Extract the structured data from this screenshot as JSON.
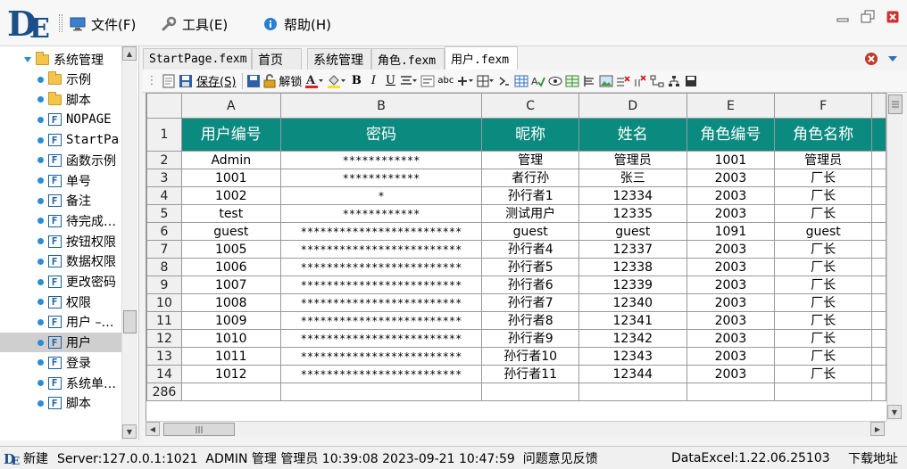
{
  "menu": {
    "file": "文件(F)",
    "tools": "工具(E)",
    "help": "帮助(H)"
  },
  "tree": {
    "root": "系统管理",
    "items": [
      {
        "label": "示例",
        "icon": "folder"
      },
      {
        "label": "脚本",
        "icon": "folder"
      },
      {
        "label": "NOPAGE",
        "icon": "function"
      },
      {
        "label": "StartPa",
        "icon": "function"
      },
      {
        "label": "函数示例",
        "icon": "function"
      },
      {
        "label": "单号",
        "icon": "function"
      },
      {
        "label": "备注",
        "icon": "function"
      },
      {
        "label": "待完成…",
        "icon": "function"
      },
      {
        "label": "按钮权限",
        "icon": "function"
      },
      {
        "label": "数据权限",
        "icon": "function"
      },
      {
        "label": "更改密码",
        "icon": "function"
      },
      {
        "label": "权限",
        "icon": "function"
      },
      {
        "label": "用户 –…",
        "icon": "function"
      },
      {
        "label": "用户",
        "icon": "function",
        "selected": true
      },
      {
        "label": "登录",
        "icon": "function"
      },
      {
        "label": "系统单…",
        "icon": "function"
      },
      {
        "label": "脚本",
        "icon": "function"
      }
    ]
  },
  "tabs": [
    {
      "label": "StartPage.fexm"
    },
    {
      "label": "首页"
    },
    {
      "label": "系统管理"
    },
    {
      "label": "角色.fexm"
    },
    {
      "label": "用户.fexm",
      "active": true
    }
  ],
  "toolbar": {
    "save": "保存(S)",
    "unlock": "解锁"
  },
  "grid": {
    "columns": [
      "A",
      "B",
      "C",
      "D",
      "E",
      "F"
    ],
    "header_row_num": "1",
    "headers": [
      "用户编号",
      "密码",
      "昵称",
      "姓名",
      "角色编号",
      "角色名称"
    ],
    "rows": [
      {
        "num": "2",
        "cells": [
          "Admin",
          "************",
          "管理",
          "管理员",
          "1001",
          "管理员"
        ]
      },
      {
        "num": "3",
        "cells": [
          "1001",
          "************",
          "者行孙",
          "张三",
          "2003",
          "厂长"
        ]
      },
      {
        "num": "4",
        "cells": [
          "1002",
          "*",
          "孙行者1",
          "12334",
          "2003",
          "厂长"
        ]
      },
      {
        "num": "5",
        "cells": [
          "test",
          "************",
          "测试用户",
          "12335",
          "2003",
          "厂长"
        ]
      },
      {
        "num": "6",
        "cells": [
          "guest",
          "*************************",
          "guest",
          "guest",
          "1091",
          "guest"
        ]
      },
      {
        "num": "7",
        "cells": [
          "1005",
          "*************************",
          "孙行者4",
          "12337",
          "2003",
          "厂长"
        ]
      },
      {
        "num": "8",
        "cells": [
          "1006",
          "*************************",
          "孙行者5",
          "12338",
          "2003",
          "厂长"
        ]
      },
      {
        "num": "9",
        "cells": [
          "1007",
          "*************************",
          "孙行者6",
          "12339",
          "2003",
          "厂长"
        ]
      },
      {
        "num": "10",
        "cells": [
          "1008",
          "*************************",
          "孙行者7",
          "12340",
          "2003",
          "厂长"
        ]
      },
      {
        "num": "11",
        "cells": [
          "1009",
          "*************************",
          "孙行者8",
          "12341",
          "2003",
          "厂长"
        ]
      },
      {
        "num": "12",
        "cells": [
          "1010",
          "*************************",
          "孙行者9",
          "12342",
          "2003",
          "厂长"
        ]
      },
      {
        "num": "13",
        "cells": [
          "1011",
          "*************************",
          "孙行者10",
          "12343",
          "2003",
          "厂长"
        ]
      },
      {
        "num": "14",
        "cells": [
          "1012",
          "*************************",
          "孙行者11",
          "12344",
          "2003",
          "厂长"
        ]
      }
    ],
    "last_row_num": "286"
  },
  "status": {
    "new": "新建",
    "info": "Server:127.0.0.1:1021  ADMIN 管理 管理员 10:39:08 2023-09-21 10:47:59  问题意见反馈",
    "version": "DataExcel:1.22.06.25103",
    "download": "下载地址"
  },
  "colors": {
    "header_bg": "#0b8a7f",
    "accent_blue": "#2a8dd4",
    "logo_blue": "#1b4f8a"
  }
}
